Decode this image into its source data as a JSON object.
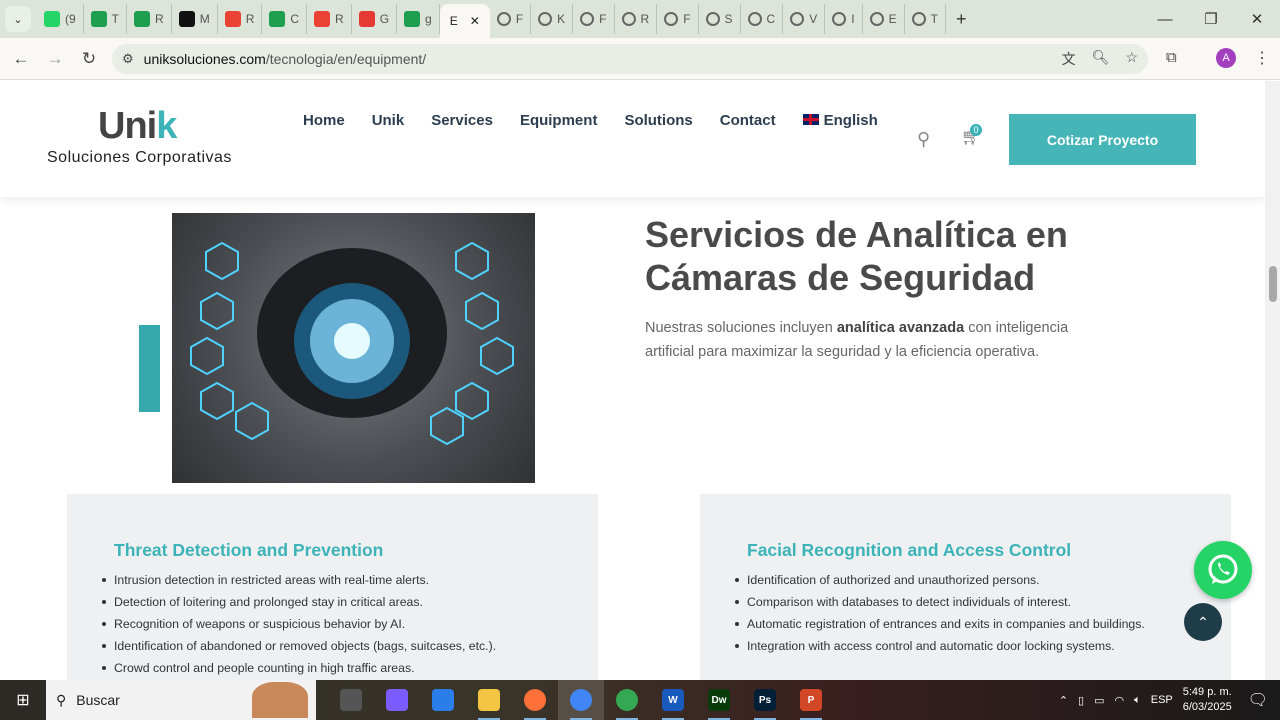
{
  "browser": {
    "tabs": [
      {
        "label": "(9",
        "icon": "whatsapp-icon",
        "color": "#25d366"
      },
      {
        "label": "T",
        "icon": "sheets-icon",
        "color": "#1e9e4f"
      },
      {
        "label": "R",
        "icon": "sheets-icon",
        "color": "#1e9e4f"
      },
      {
        "label": "M",
        "icon": "threads-icon",
        "color": "#111111"
      },
      {
        "label": "R",
        "icon": "gmail-icon",
        "color": "#ea4335"
      },
      {
        "label": "C",
        "icon": "sheets-icon",
        "color": "#1e9e4f"
      },
      {
        "label": "R",
        "icon": "gmail-icon",
        "color": "#ea4335"
      },
      {
        "label": "G",
        "icon": "app-icon",
        "color": "#e53935"
      },
      {
        "label": "g",
        "icon": "sheets-icon",
        "color": "#1e9e4f"
      }
    ],
    "active_tab": "E",
    "tabs_after": [
      "F",
      "K",
      "F",
      "R",
      "F",
      "S",
      "C",
      "V",
      "I",
      "E",
      "T"
    ],
    "url_host": "uniksoluciones.com",
    "url_path": "/tecnologia/en/equipment/",
    "profile_initial": "A"
  },
  "site": {
    "logo_main": "Uni",
    "logo_k": "k",
    "logo_sub": "Soluciones Corporativas",
    "menu": [
      "Home",
      "Unik",
      "Services",
      "Equipment",
      "Solutions",
      "Contact"
    ],
    "language": "English",
    "cart_count": "0",
    "cta": "Cotizar Proyecto",
    "accent": "#45b5b8"
  },
  "section": {
    "title_line1": "Servicios de Analítica en",
    "title_line2": "Cámaras de Seguridad",
    "desc_pre": "Nuestras soluciones incluyen ",
    "desc_bold": "analítica avanzada",
    "desc_post": " con inteligencia artificial para maximizar la seguridad y la eficiencia operativa."
  },
  "cards": [
    {
      "title": "Threat Detection and Prevention",
      "items": [
        "Intrusion detection in restricted areas with real-time alerts.",
        "Detection of loitering and prolonged stay in critical areas.",
        "Recognition of weapons or suspicious behavior by AI.",
        "Identification of abandoned or removed objects (bags, suitcases, etc.).",
        "Crowd control and people counting in high traffic areas."
      ]
    },
    {
      "title": "Facial Recognition and Access Control",
      "items": [
        "Identification of authorized and unauthorized persons.",
        "Comparison with databases to detect individuals of interest.",
        "Automatic registration of entrances and exits in companies and buildings.",
        "Integration with access control and automatic door locking systems."
      ]
    }
  ],
  "taskbar": {
    "search": "Buscar",
    "apps": [
      {
        "name": "task-view",
        "label": "",
        "color": "#555"
      },
      {
        "name": "copilot",
        "label": "",
        "color": "#7a5cff"
      },
      {
        "name": "store",
        "label": "",
        "color": "#2b7de9"
      },
      {
        "name": "file-explorer",
        "label": "",
        "color": "#f4c542"
      },
      {
        "name": "firefox",
        "label": "",
        "color": "#ff7139"
      },
      {
        "name": "chrome",
        "label": "",
        "color": "#4285f4"
      },
      {
        "name": "chrome-2",
        "label": "",
        "color": "#34a853"
      },
      {
        "name": "word",
        "label": "W",
        "color": "#185abd"
      },
      {
        "name": "dreamweaver",
        "label": "Dw",
        "color": "#0a3b0a"
      },
      {
        "name": "photoshop",
        "label": "Ps",
        "color": "#001e36"
      },
      {
        "name": "powerpoint",
        "label": "P",
        "color": "#d24726"
      }
    ],
    "lang": "ESP",
    "time": "5:49 p. m.",
    "date": "6/03/2025"
  }
}
